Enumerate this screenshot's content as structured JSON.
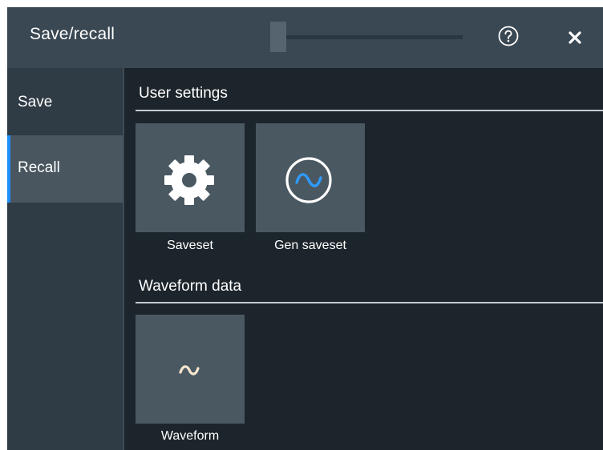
{
  "dialog": {
    "title": "Save/recall",
    "help_icon": "help-circle-icon",
    "close_icon": "close-icon"
  },
  "sidebar": {
    "items": [
      {
        "label": "Save",
        "active": false
      },
      {
        "label": "Recall",
        "active": true
      }
    ],
    "active_color": "#1e90ff"
  },
  "sections": {
    "user_settings": {
      "title": "User settings",
      "tiles": [
        {
          "label": "Saveset",
          "icon": "gear-icon"
        },
        {
          "label": "Gen saveset",
          "icon": "generator-sine-icon",
          "icon_color": "#2f9bff"
        }
      ]
    },
    "waveform_data": {
      "title": "Waveform data",
      "tiles": [
        {
          "label": "Waveform",
          "icon": "sine-wave-icon",
          "icon_color": "#f7e6cf"
        }
      ]
    }
  }
}
